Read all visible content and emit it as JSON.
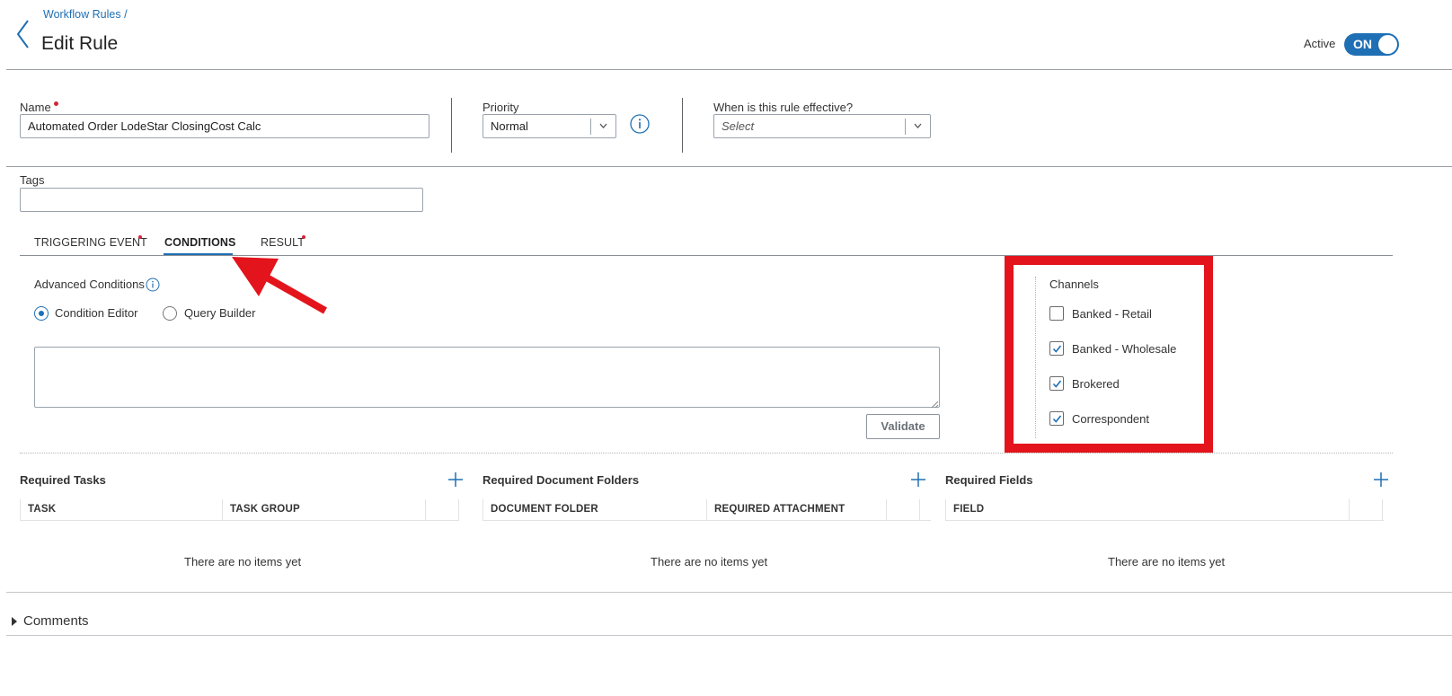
{
  "header": {
    "breadcrumb": "Workflow Rules /",
    "title": "Edit Rule",
    "active_label": "Active",
    "toggle_label": "ON"
  },
  "form": {
    "name_label": "Name",
    "name_value": "Automated Order LodeStar ClosingCost Calc",
    "priority_label": "Priority",
    "priority_value": "Normal",
    "effective_label": "When is this rule effective?",
    "effective_placeholder": "Select",
    "tags_label": "Tags",
    "tags_value": ""
  },
  "tabs": [
    {
      "label": "TRIGGERING EVENT",
      "required": true
    },
    {
      "label": "CONDITIONS",
      "active": true
    },
    {
      "label": "RESULT",
      "required": true
    }
  ],
  "conditions": {
    "advanced_label": "Advanced Conditions",
    "radio_editor": "Condition Editor",
    "radio_query": "Query Builder",
    "selected": "Condition Editor",
    "editor_value": "",
    "validate_label": "Validate"
  },
  "channels": {
    "title": "Channels",
    "items": [
      {
        "label": "Banked - Retail",
        "checked": false
      },
      {
        "label": "Banked - Wholesale",
        "checked": true
      },
      {
        "label": "Brokered",
        "checked": true
      },
      {
        "label": "Correspondent",
        "checked": true
      }
    ]
  },
  "required_tasks": {
    "title": "Required Tasks",
    "columns": [
      "TASK",
      "TASK GROUP"
    ],
    "empty": "There are no items yet"
  },
  "required_folders": {
    "title": "Required Document Folders",
    "columns": [
      "DOCUMENT FOLDER",
      "REQUIRED ATTACHMENT"
    ],
    "empty": "There are no items yet"
  },
  "required_fields": {
    "title": "Required Fields",
    "columns": [
      "FIELD"
    ],
    "empty": "There are no items yet"
  },
  "comments": {
    "label": "Comments"
  },
  "colors": {
    "accent": "#1f6fb5",
    "required": "#d0263a",
    "highlight": "#e3141b"
  },
  "icons": [
    "back-chevron-icon",
    "info-icon",
    "chevron-down-icon",
    "plus-icon",
    "caret-right-icon",
    "checkmark-icon"
  ]
}
